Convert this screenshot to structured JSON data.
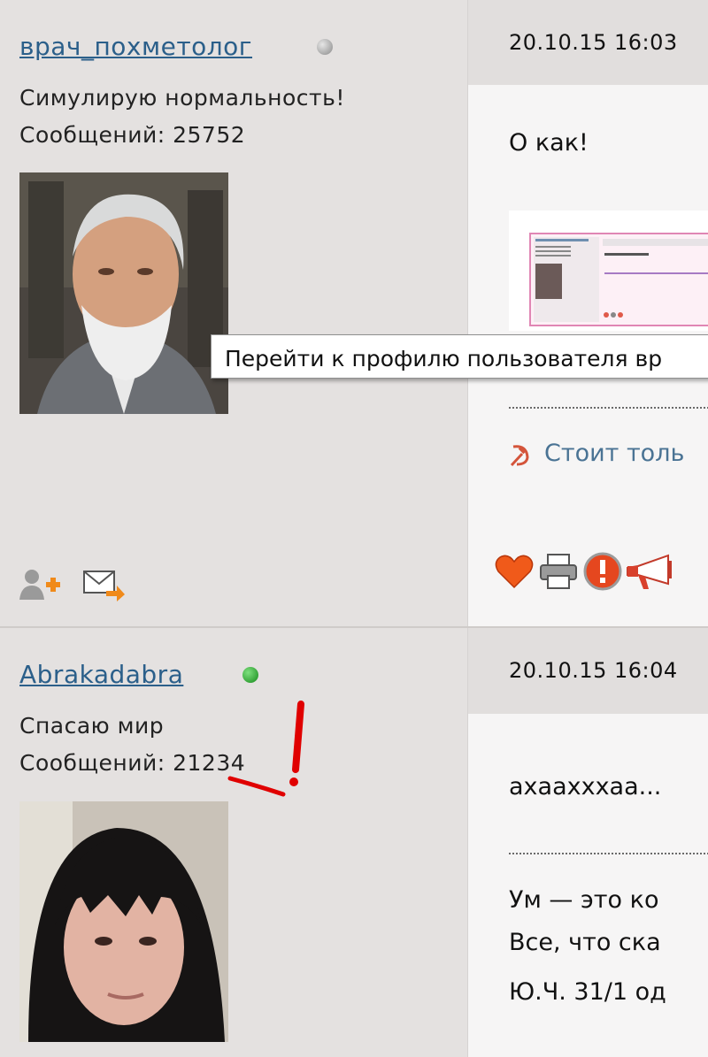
{
  "posts": [
    {
      "username": "врач_похметолог",
      "status": "Симулирую нормальность!",
      "messages_label": "Сообщений: 25752",
      "date": "20.10.15 16:03",
      "text": "О как!",
      "signature": "Стоит толь",
      "online": false
    },
    {
      "username": "Abrakadabra",
      "status": "Спасаю мир",
      "messages_label": "Сообщений: 21234",
      "date": "20.10.15 16:04",
      "text": "ахааxxxаа...",
      "signature_lines": [
        "Ум — это ко",
        "Все, что ска",
        "Ю.Ч. 31/1 од"
      ],
      "online": true
    }
  ],
  "tooltip": "Перейти к профилю пользователя вр",
  "colors": {
    "link": "#2b5f8a",
    "online": "#1e9a20",
    "offline": "#999999",
    "annotation": "#e00000"
  }
}
